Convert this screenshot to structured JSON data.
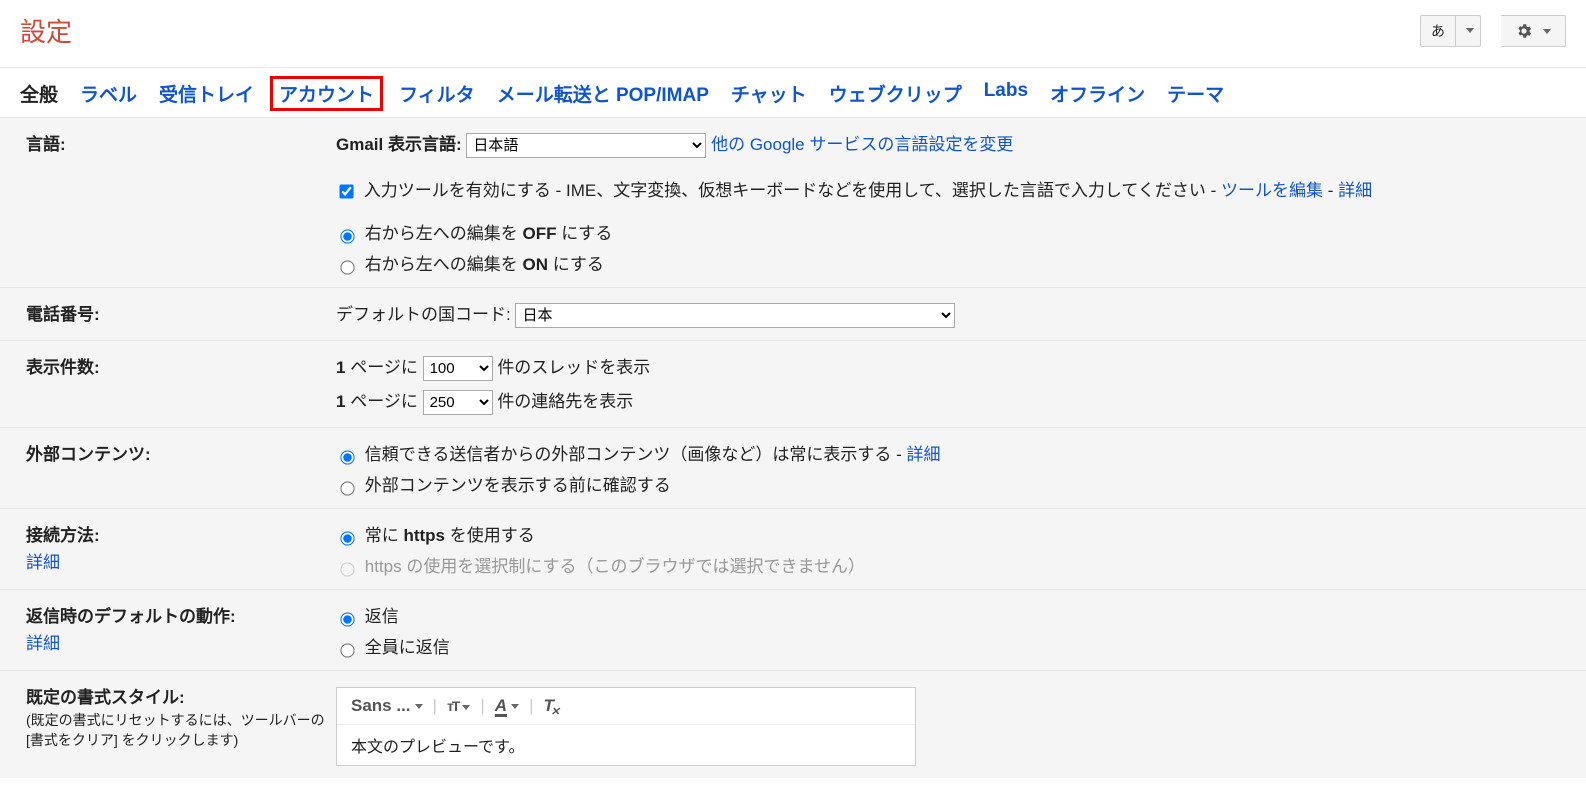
{
  "header": {
    "title": "設定",
    "lang_btn": "あ"
  },
  "tabs": [
    "全般",
    "ラベル",
    "受信トレイ",
    "アカウント",
    "フィルタ",
    "メール転送と POP/IMAP",
    "チャット",
    "ウェブクリップ",
    "Labs",
    "オフライン",
    "テーマ"
  ],
  "active_tab": "全般",
  "highlight_tab": "アカウント",
  "language": {
    "label": "言語:",
    "display_label": "Gmail 表示言語:",
    "select_value": "日本語",
    "other_link": "他の Google サービスの言語設定を変更",
    "enable_ime_text": "入力ツールを有効にする - IME、文字変換、仮想キーボードなどを使用して、選択した言語で入力してください - ",
    "edit_tool_link": "ツールを編集",
    "detail_link": "詳細",
    "rtl_off_prefix": "右から左への編集を ",
    "rtl_off_bold": "OFF",
    "rtl_off_suffix": " にする",
    "rtl_on_prefix": "右から左への編集を ",
    "rtl_on_bold": "ON",
    "rtl_on_suffix": " にする"
  },
  "phone": {
    "label": "電話番号:",
    "default_label": "デフォルトの国コード:",
    "select_value": "日本"
  },
  "page_size": {
    "label": "表示件数:",
    "line1_prefix": "1",
    "line1_mid": " ページに ",
    "line1_select": "100",
    "line1_suffix": " 件のスレッドを表示",
    "line2_prefix": "1",
    "line2_mid": " ページに ",
    "line2_select": "250",
    "line2_suffix": " 件の連絡先を表示"
  },
  "external": {
    "label": "外部コンテンツ:",
    "opt1": "信頼できる送信者からの外部コンテンツ（画像など）は常に表示する - ",
    "opt1_detail": "詳細",
    "opt2": "外部コンテンツを表示する前に確認する"
  },
  "connection": {
    "label": "接続方法:",
    "detail": "詳細",
    "opt1_prefix": "常に ",
    "opt1_bold": "https",
    "opt1_suffix": " を使用する",
    "opt2": "https の使用を選択制にする（このブラウザでは選択できません）"
  },
  "reply": {
    "label": "返信時のデフォルトの動作:",
    "detail": "詳細",
    "opt1": "返信",
    "opt2": "全員に返信"
  },
  "style": {
    "label": "既定の書式スタイル:",
    "sub": "(既定の書式にリセットするには、ツールバーの [書式をクリア] をクリックします)",
    "font_name": "Sans ...",
    "preview_text": "本文のプレビューです。"
  }
}
